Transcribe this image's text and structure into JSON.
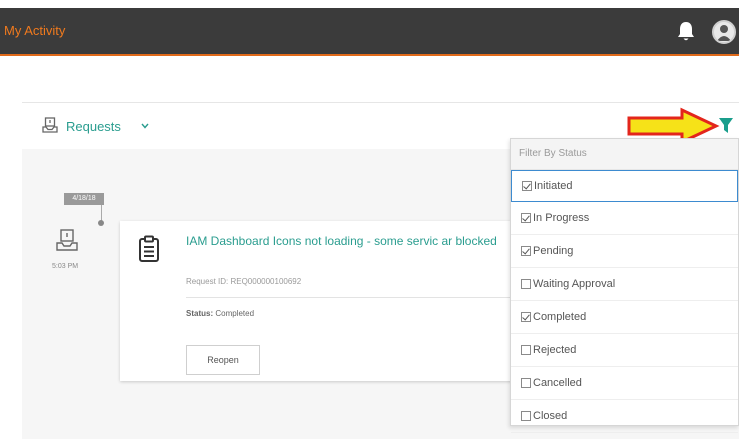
{
  "header": {
    "title": "My Activity"
  },
  "panel": {
    "requests_label": "Requests",
    "timeline": {
      "date": "4/18/18",
      "time": "5:03 PM"
    },
    "card": {
      "title": "IAM Dashboard Icons not loading - some servic ar blocked",
      "request_id": "Request ID: REQ000000100692",
      "status_key": "Status:",
      "status_value": "Completed",
      "reopen_label": "Reopen"
    }
  },
  "filter": {
    "heading": "Filter By Status",
    "options": [
      {
        "label": "Initiated",
        "checked": true
      },
      {
        "label": "In Progress",
        "checked": true
      },
      {
        "label": "Pending",
        "checked": true
      },
      {
        "label": "Waiting Approval",
        "checked": false
      },
      {
        "label": "Completed",
        "checked": true
      },
      {
        "label": "Rejected",
        "checked": false
      },
      {
        "label": "Cancelled",
        "checked": false
      },
      {
        "label": "Closed",
        "checked": false
      }
    ]
  },
  "colors": {
    "topbar": "#3b3b3b",
    "brand_orange": "#f07a1e",
    "accent_teal": "#2a9d8f",
    "arrow_yellow": "#f6e218",
    "arrow_red": "#e3261c"
  },
  "icons": [
    "bell-icon",
    "user-avatar-icon",
    "request-icon",
    "chevron-down-icon",
    "filter-funnel-icon",
    "clipboard-icon",
    "annotation-arrow"
  ]
}
